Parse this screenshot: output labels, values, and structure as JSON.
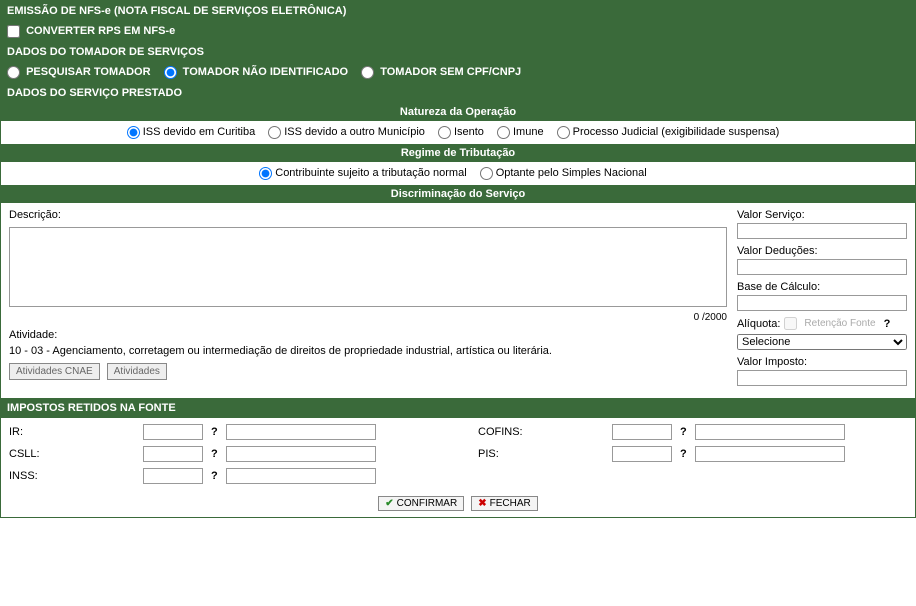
{
  "header": {
    "title": "EMISSÃO DE NFS-e (NOTA FISCAL DE SERVIÇOS ELETRÔNICA)"
  },
  "converter": {
    "label": "CONVERTER RPS EM NFS-e"
  },
  "tomador": {
    "title": "DADOS DO TOMADOR DE SERVIÇOS",
    "opt_pesquisar": "PESQUISAR TOMADOR",
    "opt_nao_identificado": "TOMADOR NÃO IDENTIFICADO",
    "opt_sem_cpf": "TOMADOR SEM CPF/CNPJ"
  },
  "servico": {
    "title": "DADOS DO SERVIÇO PRESTADO",
    "natureza_title": "Natureza da Operação",
    "natureza": {
      "opt1": "ISS devido em Curitiba",
      "opt2": "ISS devido a outro Município",
      "opt3": "Isento",
      "opt4": "Imune",
      "opt5": "Processo Judicial (exigibilidade suspensa)"
    },
    "regime_title": "Regime de Tributação",
    "regime": {
      "opt1": "Contribuinte sujeito a tributação normal",
      "opt2": "Optante pelo Simples Nacional"
    },
    "disc_title": "Discriminação do Serviço",
    "descricao_label": "Descrição:",
    "char_count": "0 /2000",
    "atividade_label": "Atividade:",
    "atividade_text": "10 - 03 - Agenciamento, corretagem ou intermediação de direitos de propriedade industrial, artística ou literária.",
    "btn_atividades_cnae": "Atividades CNAE",
    "btn_atividades": "Atividades",
    "valor_servico_label": "Valor Serviço:",
    "valor_deducoes_label": "Valor Deduções:",
    "base_calculo_label": "Base de Cálculo:",
    "aliquota_label": "Alíquota:",
    "retencao_label": "Retenção Fonte",
    "help_q": "?",
    "aliquota_selecione": "Selecione",
    "valor_imposto_label": "Valor Imposto:"
  },
  "impostos": {
    "title": "IMPOSTOS RETIDOS NA FONTE",
    "ir": "IR:",
    "csll": "CSLL:",
    "inss": "INSS:",
    "cofins": "COFINS:",
    "pis": "PIS:",
    "help_q": "?"
  },
  "footer": {
    "confirmar": "CONFIRMAR",
    "fechar": "FECHAR"
  }
}
